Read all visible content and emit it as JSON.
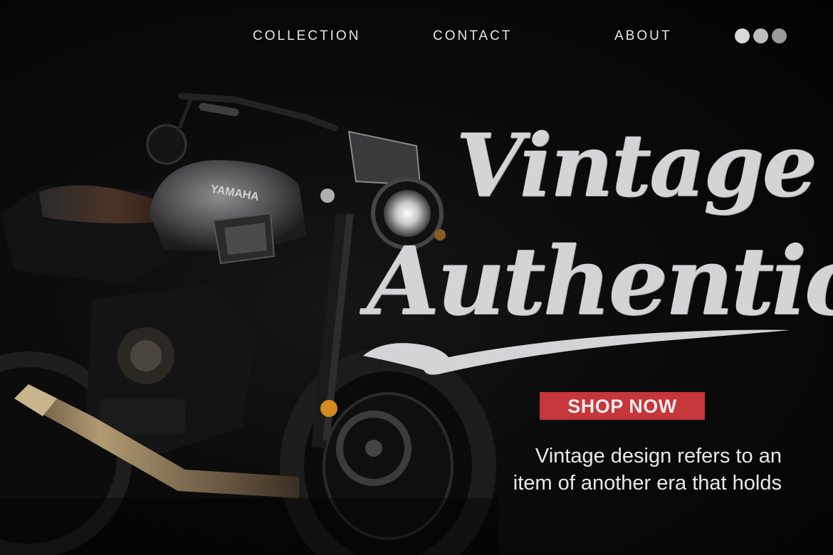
{
  "nav": {
    "items": [
      {
        "label": "COLLECTION"
      },
      {
        "label": "CONTACT"
      },
      {
        "label": "ABOUT"
      }
    ],
    "dot_colors": [
      "#d9d9d9",
      "#bdbdbd",
      "#9a9a9a"
    ]
  },
  "hero": {
    "line1": "Vintage",
    "line2": "Authentic",
    "cta_label": "SHOP NOW",
    "description_line1": "Vintage design refers to an",
    "description_line2": "item of another era that holds",
    "bike_brand": "YAMAHA"
  },
  "colors": {
    "background": "#050505",
    "headline": "#d4d4d6",
    "cta": "#c6363a"
  }
}
